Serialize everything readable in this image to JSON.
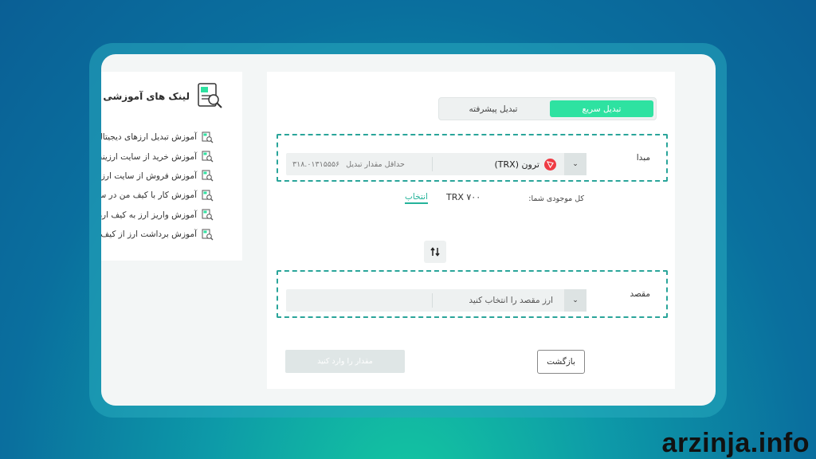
{
  "sidebar": {
    "title": "لینک های آموزشی",
    "items": [
      {
        "label": "آموزش تبدیل ارزهای دیجیتال"
      },
      {
        "label": "آموزش خرید از سایت ارزینجا"
      },
      {
        "label": "آموزش فروش از سایت ارزینجا"
      },
      {
        "label": "آموزش کار با کیف من در سایت"
      },
      {
        "label": "آموزش واریز ارز به کیف ارزینجا"
      },
      {
        "label": "آموزش برداشت ارز از کیف ارزینجا"
      }
    ]
  },
  "tabs": {
    "quick": "تبدیل سریع",
    "advanced": "تبدیل پیشرفته"
  },
  "source": {
    "label": "مبدا",
    "coin": "ترون (TRX)",
    "min_label": "حداقل مقدار تبدیل",
    "min_value": "۳۱۸.۰۱۳۱۵۵۵۶"
  },
  "balance": {
    "label": "کل موجودی شما:",
    "value": "TRX ۷۰۰",
    "select": "انتخاب"
  },
  "destination": {
    "label": "مقصد",
    "placeholder": "ارز مقصد را انتخاب کنید"
  },
  "buttons": {
    "back": "بازگشت",
    "enter_amount": "مقدار را وارد کنید"
  },
  "watermark": "arzinja.info",
  "colors": {
    "accent": "#2ee2a1",
    "dashed_border": "#2aa59a",
    "link": "#25b39a",
    "trx": "#ef3b44"
  }
}
